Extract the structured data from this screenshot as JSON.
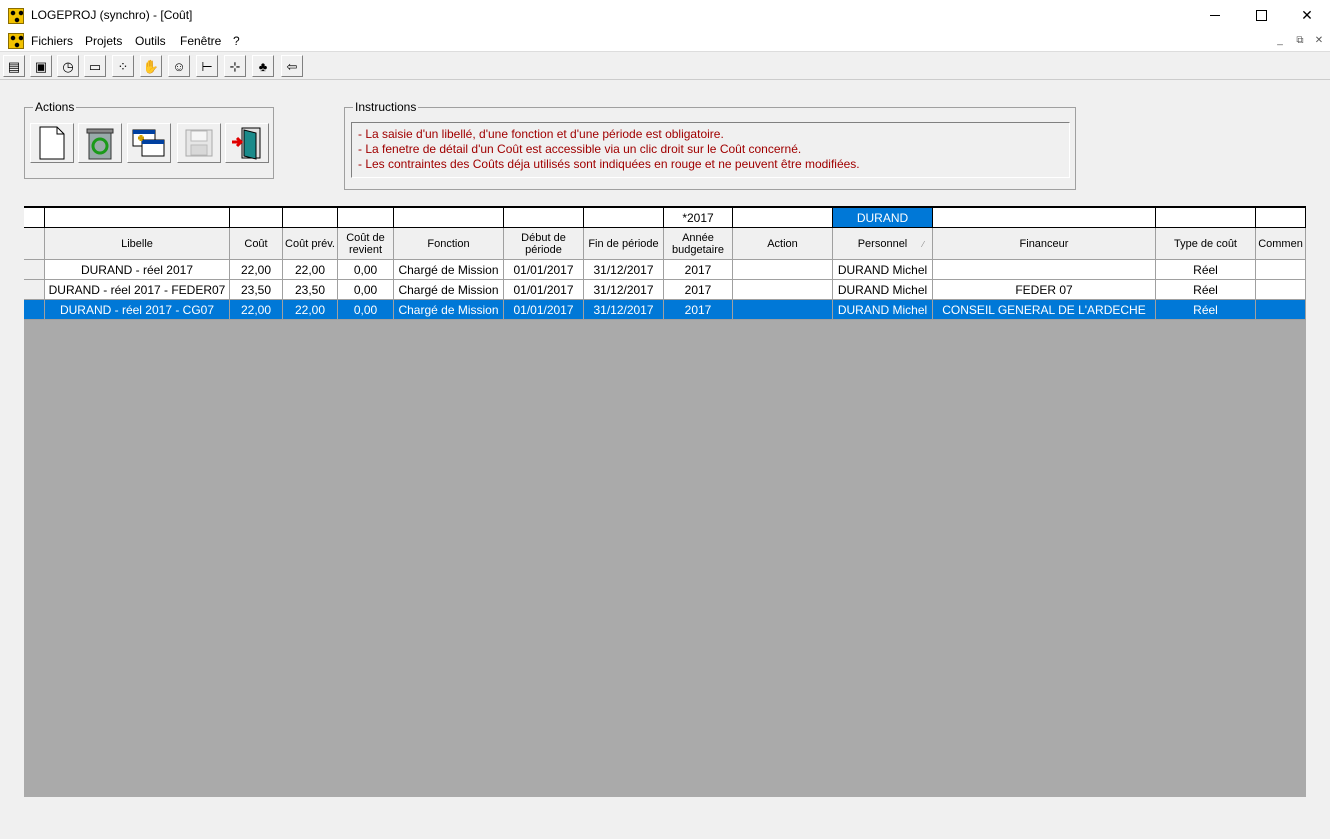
{
  "window": {
    "title": "LOGEPROJ (synchro) - [Coût]",
    "min_symbol": "",
    "close_symbol": "✕"
  },
  "menu": {
    "items": [
      "Fichiers",
      "Projets",
      "Outils",
      "Fenêtre",
      "?"
    ],
    "mdi_min": "_",
    "mdi_restore": "⧉",
    "mdi_close": "✕"
  },
  "toolbar": {
    "icons": [
      "grid-list-icon",
      "image-icon",
      "stopwatch-icon",
      "document-icon",
      "network-icon",
      "handshake-icon",
      "person-icon",
      "tree-icon",
      "hierarchy-icon",
      "money-bag-icon",
      "exit-door-icon"
    ],
    "glyphs": [
      "▤",
      "▣",
      "◷",
      "▭",
      "⁘",
      "✋",
      "☺",
      "⊢",
      "⊹",
      "♣",
      "⇦"
    ]
  },
  "actions": {
    "label": "Actions",
    "buttons": [
      "new-document",
      "recycle-bin",
      "duplicate-windows",
      "save-floppy",
      "exit-door"
    ]
  },
  "instructions": {
    "label": "Instructions",
    "lines": [
      "- La saisie d'un libellé, d'une fonction et d'une période est obligatoire.",
      "- La fenetre de détail d'un Coût est accessible via un clic droit sur le Coût concerné.",
      "- Les contraintes des Coûts déja utilisés sont indiquées en rouge et ne peuvent être modifiées."
    ]
  },
  "grid": {
    "filters": [
      "",
      "",
      "",
      "",
      "",
      "",
      "",
      "*2017",
      "",
      "DURAND",
      "",
      "",
      ""
    ],
    "selected_filter_index": 9,
    "headers": [
      "Libelle",
      "Coût",
      "Coût prév.",
      "Coût de revient",
      "Fonction",
      "Début de période",
      "Fin de période",
      "Année budgetaire",
      "Action",
      "Personnel",
      "Financeur",
      "Type de coût",
      "Commen"
    ],
    "sort_indicator": "⁄",
    "rows": [
      [
        "DURAND - réel 2017",
        "22,00",
        "22,00",
        "0,00",
        "Chargé de Mission",
        "01/01/2017",
        "31/12/2017",
        "2017",
        "",
        "DURAND Michel",
        "",
        "Réel",
        ""
      ],
      [
        "DURAND - réel 2017 - FEDER07",
        "23,50",
        "23,50",
        "0,00",
        "Chargé de Mission",
        "01/01/2017",
        "31/12/2017",
        "2017",
        "",
        "DURAND Michel",
        "FEDER 07",
        "Réel",
        ""
      ],
      [
        "DURAND - réel 2017 - CG07",
        "22,00",
        "22,00",
        "0,00",
        "Chargé de Mission",
        "01/01/2017",
        "31/12/2017",
        "2017",
        "",
        "DURAND Michel",
        "CONSEIL GENERAL DE L'ARDECHE",
        "Réel",
        ""
      ]
    ],
    "selected_row_index": 2
  }
}
